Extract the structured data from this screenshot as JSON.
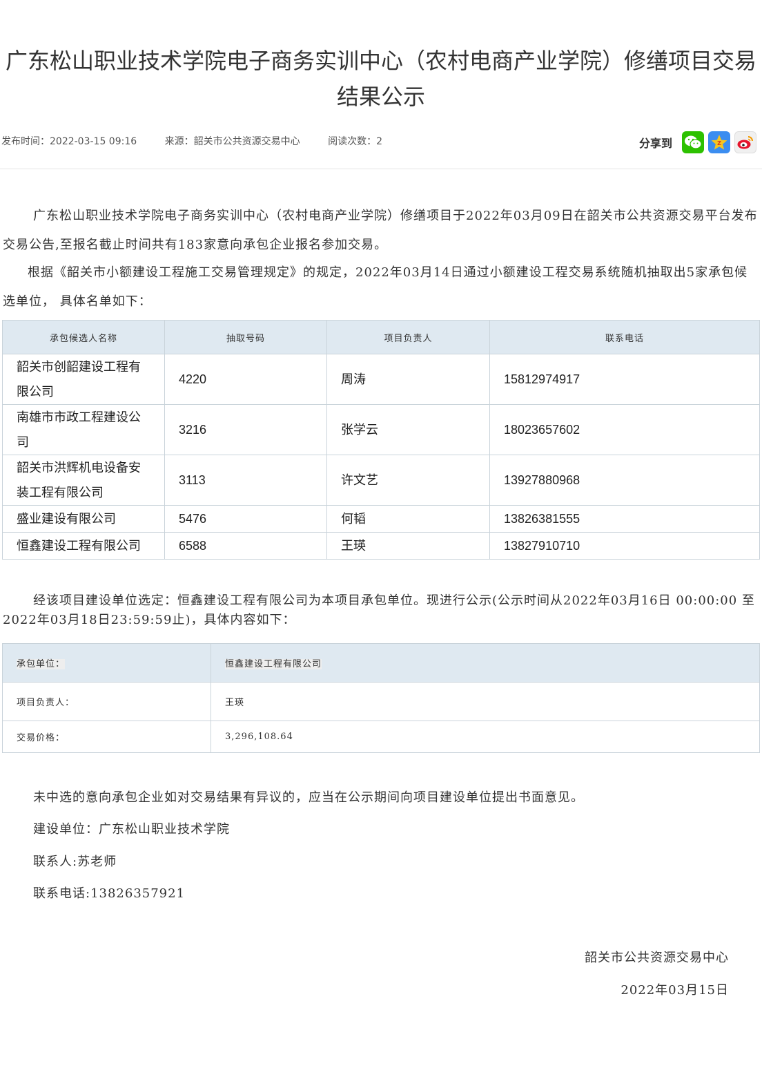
{
  "title": "广东松山职业技术学院电子商务实训中心（农村电商产业学院）修缮项目交易结果公示",
  "meta": {
    "publish": "发布时间：2022-03-15 09:16",
    "source": "来源：韶关市公共资源交易中心",
    "reads": "阅读次数：2"
  },
  "share": {
    "label": "分享到",
    "wechat_icon": "wechat-icon",
    "qzone_icon": "qzone-icon",
    "weibo_icon": "weibo-icon"
  },
  "paragraphs": {
    "p1": "广东松山职业技术学院电子商务实训中心（农村电商产业学院）修缮项目于2022年03月09日在韶关市公共资源交易平台发布交易公告,至报名截止时间共有183家意向承包企业报名参加交易。",
    "p2": "根据《韶关市小额建设工程施工交易管理规定》的规定，2022年03月14日通过小额建设工程交易系统随机抽取出5家承包候选单位， 具体名单如下：",
    "p3": "经该项目建设单位选定：恒鑫建设工程有限公司为本项目承包单位。现进行公示(公示时间从2022年03月16日 00:00:00 至 2022年03月18日23:59:59止)，具体内容如下："
  },
  "candidates": {
    "headers": [
      "承包候选人名称",
      "抽取号码",
      "项目负责人",
      "联系电话"
    ],
    "rows": [
      [
        "韶关市创韶建设工程有限公司",
        "4220",
        "周涛",
        "15812974917"
      ],
      [
        "南雄市市政工程建设公司",
        "3216",
        "张学云",
        "18023657602"
      ],
      [
        "韶关市洪辉机电设备安装工程有限公司",
        "3113",
        "许文艺",
        "13927880968"
      ],
      [
        "盛业建设有限公司",
        "5476",
        "何韬",
        "13826381555"
      ],
      [
        "恒鑫建设工程有限公司",
        "6588",
        "王瑛",
        "13827910710"
      ]
    ]
  },
  "result": {
    "rows": [
      [
        "承包单位：",
        "恒鑫建设工程有限公司"
      ],
      [
        "项目负责人：",
        "王瑛"
      ],
      [
        "交易价格：",
        "3,296,108.64"
      ]
    ]
  },
  "footer": {
    "objection": "未中选的意向承包企业如对交易结果有异议的，应当在公示期间向项目建设单位提出书面意见。",
    "builder": "建设单位：广东松山职业技术学院",
    "contact": "联系人:苏老师",
    "phone": "联系电话:13826357921"
  },
  "signature": {
    "org": "韶关市公共资源交易中心",
    "date": "2022年03月15日"
  }
}
